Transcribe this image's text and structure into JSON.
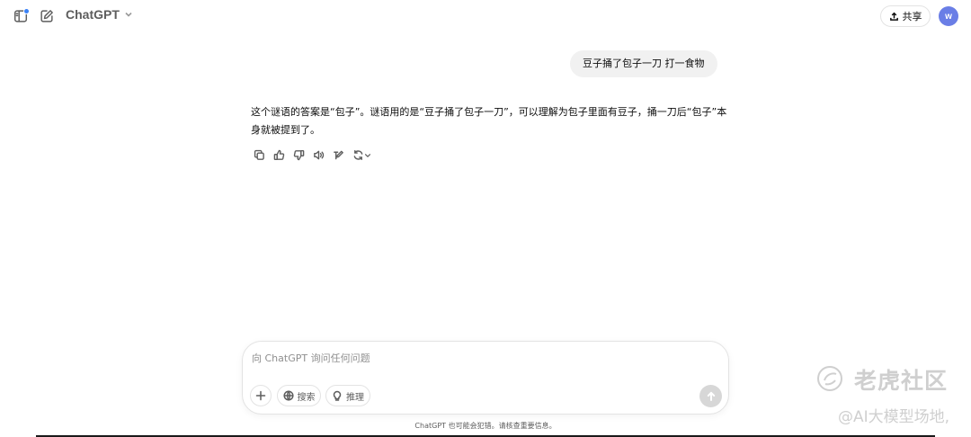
{
  "header": {
    "model_name": "ChatGPT",
    "share_label": "共享",
    "avatar_initial": "w"
  },
  "conversation": {
    "user_message": "豆子捅了包子一刀 打一食物",
    "assistant_message": "这个谜语的答案是“包子”。谜语用的是“豆子捅了包子一刀”，可以理解为包子里面有豆子，捅一刀后“包子”本身就被提到了。",
    "actions": [
      "copy-icon",
      "thumbs-up-icon",
      "thumbs-down-icon",
      "read-aloud-icon",
      "edit-canvas-icon",
      "regenerate-icon"
    ]
  },
  "composer": {
    "placeholder": "向 ChatGPT 询问任何问题",
    "search_label": "搜索",
    "reason_label": "推理"
  },
  "footer": {
    "disclaimer": "ChatGPT 也可能会犯错。请核查重要信息。"
  },
  "watermark": {
    "brand": "老虎社区",
    "sub": "@AI大模型场地,"
  },
  "colors": {
    "avatar": "#6a7ee6",
    "notification_dot": "#3b82f6",
    "user_bubble": "#f1f1f1",
    "send_button_disabled": "#d7d7d7"
  }
}
